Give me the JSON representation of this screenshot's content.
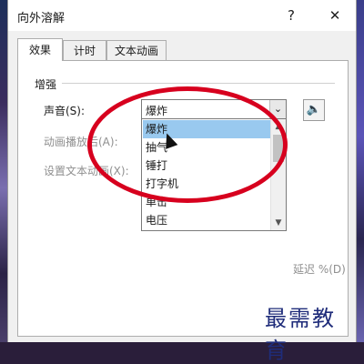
{
  "window": {
    "title": "向外溶解",
    "help_label": "?",
    "close_label": "✕"
  },
  "tabs": [
    {
      "label": "效果"
    },
    {
      "label": "计时"
    },
    {
      "label": "文本动画"
    }
  ],
  "group": {
    "label": "增强"
  },
  "fields": {
    "sound_label": "声音(S):",
    "sound_value": "爆炸",
    "after_anim_label": "动画播放后(A):",
    "animate_text_label": "设置文本动画(X):",
    "delay_partial": "延迟 %(D)"
  },
  "dropdown": {
    "options": [
      "爆炸",
      "抽气",
      "锤打",
      "打字机",
      "单击",
      "电压"
    ],
    "selected_index": 0
  },
  "icons": {
    "dropdown_arrow": "chevron-down-icon",
    "speaker": "speaker-icon"
  },
  "watermark": "最需教育",
  "colors": {
    "highlight": "#99c9ef",
    "annotation": "#d7001e",
    "watermark": "#1f2c7a"
  }
}
